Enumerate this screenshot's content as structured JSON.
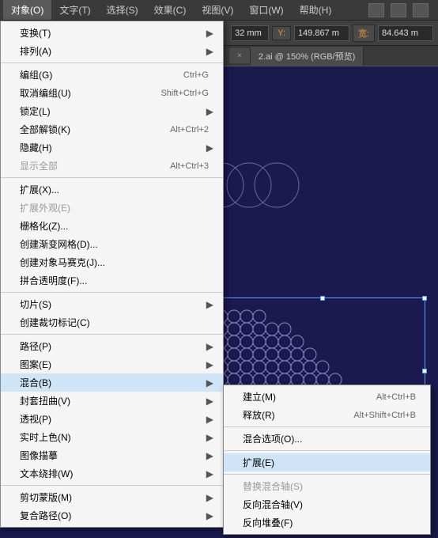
{
  "menubar": {
    "items": [
      {
        "label": "对象(O)",
        "active": true
      },
      {
        "label": "文字(T)"
      },
      {
        "label": "选择(S)"
      },
      {
        "label": "效果(C)"
      },
      {
        "label": "视图(V)"
      },
      {
        "label": "窗口(W)"
      },
      {
        "label": "帮助(H)"
      }
    ]
  },
  "options_bar": {
    "x_value": "32 mm",
    "y_label": "Y:",
    "y_value": "149.867 m",
    "w_label": "宽:",
    "w_value": "84.643 m"
  },
  "tabs": {
    "tab1_x": "×",
    "tab2_label": "2.ai @ 150% (RGB/预览)"
  },
  "dropdown": [
    {
      "label": "变换(T)",
      "arrow": true
    },
    {
      "label": "排列(A)",
      "arrow": true
    },
    null,
    {
      "label": "编组(G)",
      "shortcut": "Ctrl+G"
    },
    {
      "label": "取消编组(U)",
      "shortcut": "Shift+Ctrl+G"
    },
    {
      "label": "锁定(L)",
      "arrow": true
    },
    {
      "label": "全部解锁(K)",
      "shortcut": "Alt+Ctrl+2"
    },
    {
      "label": "隐藏(H)",
      "arrow": true
    },
    {
      "label": "显示全部",
      "shortcut": "Alt+Ctrl+3",
      "disabled": true
    },
    null,
    {
      "label": "扩展(X)..."
    },
    {
      "label": "扩展外观(E)",
      "disabled": true
    },
    {
      "label": "栅格化(Z)..."
    },
    {
      "label": "创建渐变网格(D)..."
    },
    {
      "label": "创建对象马赛克(J)..."
    },
    {
      "label": "拼合透明度(F)..."
    },
    null,
    {
      "label": "切片(S)",
      "arrow": true
    },
    {
      "label": "创建裁切标记(C)"
    },
    null,
    {
      "label": "路径(P)",
      "arrow": true
    },
    {
      "label": "图案(E)",
      "arrow": true
    },
    {
      "label": "混合(B)",
      "arrow": true,
      "highlighted": true
    },
    {
      "label": "封套扭曲(V)",
      "arrow": true
    },
    {
      "label": "透视(P)",
      "arrow": true
    },
    {
      "label": "实时上色(N)",
      "arrow": true
    },
    {
      "label": "图像描摹",
      "arrow": true
    },
    {
      "label": "文本绕排(W)",
      "arrow": true
    },
    null,
    {
      "label": "剪切蒙版(M)",
      "arrow": true
    },
    {
      "label": "复合路径(O)",
      "arrow": true
    }
  ],
  "submenu": [
    {
      "label": "建立(M)",
      "shortcut": "Alt+Ctrl+B"
    },
    {
      "label": "释放(R)",
      "shortcut": "Alt+Shift+Ctrl+B"
    },
    null,
    {
      "label": "混合选项(O)..."
    },
    null,
    {
      "label": "扩展(E)",
      "highlighted": true
    },
    null,
    {
      "label": "替换混合轴(S)",
      "disabled": true
    },
    {
      "label": "反向混合轴(V)"
    },
    {
      "label": "反向堆叠(F)"
    }
  ]
}
